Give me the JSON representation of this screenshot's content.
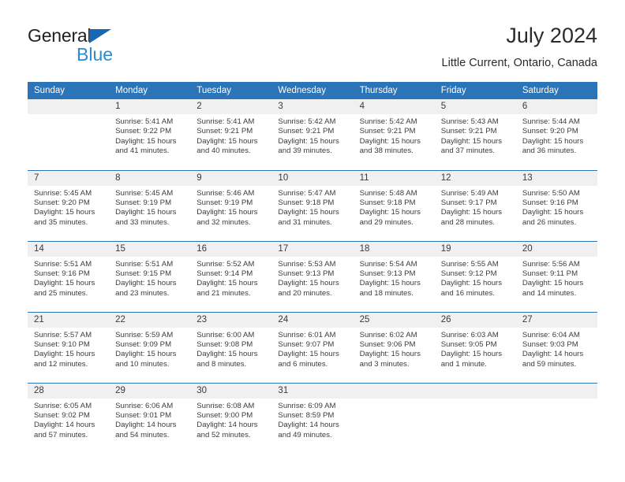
{
  "brand": {
    "word_general": "General",
    "word_blue": "Blue",
    "triangle_color": "#1668b3",
    "blue_color": "#2e8bd0"
  },
  "header": {
    "title": "July 2024",
    "subtitle": "Little Current, Ontario, Canada"
  },
  "theme": {
    "header_row_bg": "#2a74b7",
    "header_row_text": "#ffffff",
    "daynum_bg": "#f0f0f0",
    "week_divider": "#2a74b7",
    "body_text": "#3c3c3c"
  },
  "calendar": {
    "weekday_headers": [
      "Sunday",
      "Monday",
      "Tuesday",
      "Wednesday",
      "Thursday",
      "Friday",
      "Saturday"
    ],
    "weeks": [
      [
        {
          "day": "",
          "lines": []
        },
        {
          "day": "1",
          "lines": [
            "Sunrise: 5:41 AM",
            "Sunset: 9:22 PM",
            "Daylight: 15 hours",
            "and 41 minutes."
          ]
        },
        {
          "day": "2",
          "lines": [
            "Sunrise: 5:41 AM",
            "Sunset: 9:21 PM",
            "Daylight: 15 hours",
            "and 40 minutes."
          ]
        },
        {
          "day": "3",
          "lines": [
            "Sunrise: 5:42 AM",
            "Sunset: 9:21 PM",
            "Daylight: 15 hours",
            "and 39 minutes."
          ]
        },
        {
          "day": "4",
          "lines": [
            "Sunrise: 5:42 AM",
            "Sunset: 9:21 PM",
            "Daylight: 15 hours",
            "and 38 minutes."
          ]
        },
        {
          "day": "5",
          "lines": [
            "Sunrise: 5:43 AM",
            "Sunset: 9:21 PM",
            "Daylight: 15 hours",
            "and 37 minutes."
          ]
        },
        {
          "day": "6",
          "lines": [
            "Sunrise: 5:44 AM",
            "Sunset: 9:20 PM",
            "Daylight: 15 hours",
            "and 36 minutes."
          ]
        }
      ],
      [
        {
          "day": "7",
          "lines": [
            "Sunrise: 5:45 AM",
            "Sunset: 9:20 PM",
            "Daylight: 15 hours",
            "and 35 minutes."
          ]
        },
        {
          "day": "8",
          "lines": [
            "Sunrise: 5:45 AM",
            "Sunset: 9:19 PM",
            "Daylight: 15 hours",
            "and 33 minutes."
          ]
        },
        {
          "day": "9",
          "lines": [
            "Sunrise: 5:46 AM",
            "Sunset: 9:19 PM",
            "Daylight: 15 hours",
            "and 32 minutes."
          ]
        },
        {
          "day": "10",
          "lines": [
            "Sunrise: 5:47 AM",
            "Sunset: 9:18 PM",
            "Daylight: 15 hours",
            "and 31 minutes."
          ]
        },
        {
          "day": "11",
          "lines": [
            "Sunrise: 5:48 AM",
            "Sunset: 9:18 PM",
            "Daylight: 15 hours",
            "and 29 minutes."
          ]
        },
        {
          "day": "12",
          "lines": [
            "Sunrise: 5:49 AM",
            "Sunset: 9:17 PM",
            "Daylight: 15 hours",
            "and 28 minutes."
          ]
        },
        {
          "day": "13",
          "lines": [
            "Sunrise: 5:50 AM",
            "Sunset: 9:16 PM",
            "Daylight: 15 hours",
            "and 26 minutes."
          ]
        }
      ],
      [
        {
          "day": "14",
          "lines": [
            "Sunrise: 5:51 AM",
            "Sunset: 9:16 PM",
            "Daylight: 15 hours",
            "and 25 minutes."
          ]
        },
        {
          "day": "15",
          "lines": [
            "Sunrise: 5:51 AM",
            "Sunset: 9:15 PM",
            "Daylight: 15 hours",
            "and 23 minutes."
          ]
        },
        {
          "day": "16",
          "lines": [
            "Sunrise: 5:52 AM",
            "Sunset: 9:14 PM",
            "Daylight: 15 hours",
            "and 21 minutes."
          ]
        },
        {
          "day": "17",
          "lines": [
            "Sunrise: 5:53 AM",
            "Sunset: 9:13 PM",
            "Daylight: 15 hours",
            "and 20 minutes."
          ]
        },
        {
          "day": "18",
          "lines": [
            "Sunrise: 5:54 AM",
            "Sunset: 9:13 PM",
            "Daylight: 15 hours",
            "and 18 minutes."
          ]
        },
        {
          "day": "19",
          "lines": [
            "Sunrise: 5:55 AM",
            "Sunset: 9:12 PM",
            "Daylight: 15 hours",
            "and 16 minutes."
          ]
        },
        {
          "day": "20",
          "lines": [
            "Sunrise: 5:56 AM",
            "Sunset: 9:11 PM",
            "Daylight: 15 hours",
            "and 14 minutes."
          ]
        }
      ],
      [
        {
          "day": "21",
          "lines": [
            "Sunrise: 5:57 AM",
            "Sunset: 9:10 PM",
            "Daylight: 15 hours",
            "and 12 minutes."
          ]
        },
        {
          "day": "22",
          "lines": [
            "Sunrise: 5:59 AM",
            "Sunset: 9:09 PM",
            "Daylight: 15 hours",
            "and 10 minutes."
          ]
        },
        {
          "day": "23",
          "lines": [
            "Sunrise: 6:00 AM",
            "Sunset: 9:08 PM",
            "Daylight: 15 hours",
            "and 8 minutes."
          ]
        },
        {
          "day": "24",
          "lines": [
            "Sunrise: 6:01 AM",
            "Sunset: 9:07 PM",
            "Daylight: 15 hours",
            "and 6 minutes."
          ]
        },
        {
          "day": "25",
          "lines": [
            "Sunrise: 6:02 AM",
            "Sunset: 9:06 PM",
            "Daylight: 15 hours",
            "and 3 minutes."
          ]
        },
        {
          "day": "26",
          "lines": [
            "Sunrise: 6:03 AM",
            "Sunset: 9:05 PM",
            "Daylight: 15 hours",
            "and 1 minute."
          ]
        },
        {
          "day": "27",
          "lines": [
            "Sunrise: 6:04 AM",
            "Sunset: 9:03 PM",
            "Daylight: 14 hours",
            "and 59 minutes."
          ]
        }
      ],
      [
        {
          "day": "28",
          "lines": [
            "Sunrise: 6:05 AM",
            "Sunset: 9:02 PM",
            "Daylight: 14 hours",
            "and 57 minutes."
          ]
        },
        {
          "day": "29",
          "lines": [
            "Sunrise: 6:06 AM",
            "Sunset: 9:01 PM",
            "Daylight: 14 hours",
            "and 54 minutes."
          ]
        },
        {
          "day": "30",
          "lines": [
            "Sunrise: 6:08 AM",
            "Sunset: 9:00 PM",
            "Daylight: 14 hours",
            "and 52 minutes."
          ]
        },
        {
          "day": "31",
          "lines": [
            "Sunrise: 6:09 AM",
            "Sunset: 8:59 PM",
            "Daylight: 14 hours",
            "and 49 minutes."
          ]
        },
        {
          "day": "",
          "lines": []
        },
        {
          "day": "",
          "lines": []
        },
        {
          "day": "",
          "lines": []
        }
      ]
    ]
  }
}
